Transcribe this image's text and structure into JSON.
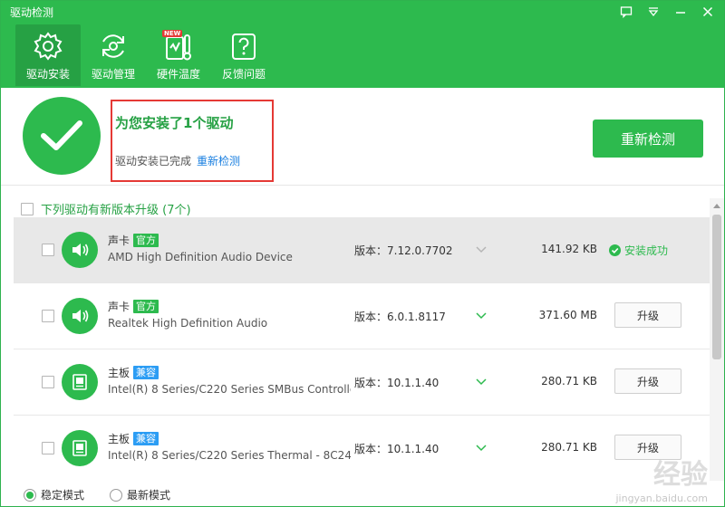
{
  "app": {
    "title": "驱动检测"
  },
  "window_controls": [
    {
      "icon": "feedback-icon"
    },
    {
      "icon": "menu-dropdown-icon"
    },
    {
      "icon": "minimize-icon"
    },
    {
      "icon": "close-icon"
    }
  ],
  "nav": {
    "items": [
      {
        "label": "驱动安装",
        "icon": "gear-icon",
        "active": true
      },
      {
        "label": "驱动管理",
        "icon": "refresh-icon",
        "active": false
      },
      {
        "label": "硬件温度",
        "icon": "thermometer-icon",
        "active": false,
        "badge": "NEW"
      },
      {
        "label": "反馈问题",
        "icon": "help-icon",
        "active": false
      }
    ]
  },
  "result": {
    "title": "为您安装了1个驱动",
    "subtitle": "驱动安装已完成",
    "link": "重新检测",
    "button": "重新检测"
  },
  "upgrade": {
    "header": "下列驱动有新版本升级 (7个)"
  },
  "drivers": [
    {
      "category": "声卡",
      "tag": "官方",
      "tag_color": "green",
      "name": "AMD High Definition Audio Device",
      "version": "版本：7.12.0.7702",
      "size": "141.92 KB",
      "status": "安装成功",
      "icon": "speaker-icon"
    },
    {
      "category": "声卡",
      "tag": "官方",
      "tag_color": "green",
      "name": "Realtek High Definition Audio",
      "version": "版本：6.0.1.8117",
      "size": "371.60 MB",
      "action": "升级",
      "icon": "speaker-icon"
    },
    {
      "category": "主板",
      "tag": "兼容",
      "tag_color": "blue",
      "name": "Intel(R) 8 Series/C220 Series SMBus Controlle",
      "version": "版本：10.1.1.40",
      "size": "280.71 KB",
      "action": "升级",
      "icon": "motherboard-icon"
    },
    {
      "category": "主板",
      "tag": "兼容",
      "tag_color": "blue",
      "name": "Intel(R) 8 Series/C220 Series Thermal - 8C24",
      "version": "版本：10.1.1.40",
      "size": "280.71 KB",
      "action": "升级",
      "icon": "motherboard-icon"
    }
  ],
  "footer": {
    "modes": [
      {
        "label": "稳定模式",
        "selected": true
      },
      {
        "label": "最新模式",
        "selected": false
      }
    ],
    "watermark": "经验",
    "watermark_sub": "jingyan.baidu.com"
  },
  "colors": {
    "brand": "#2dba4e",
    "link": "#1a7fe0",
    "highlight": "#e53935",
    "tag_blue": "#2c9df4"
  }
}
